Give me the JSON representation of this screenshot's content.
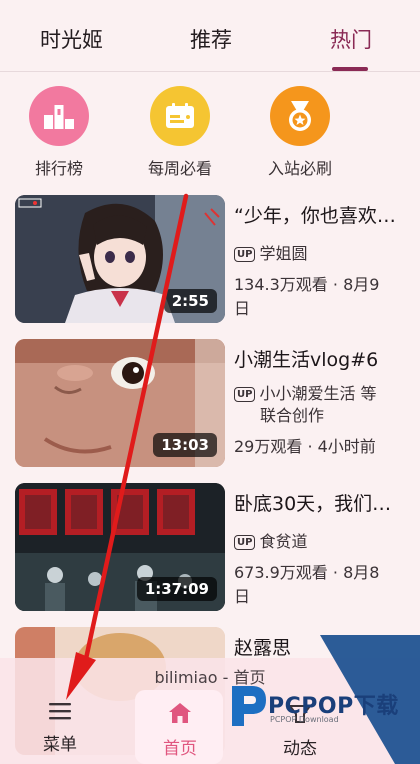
{
  "tabs": [
    {
      "label": "时光姬"
    },
    {
      "label": "推荐"
    },
    {
      "label": "热门",
      "active": true
    }
  ],
  "quick": [
    {
      "label": "排行榜",
      "icon": "ranking-icon",
      "color": "#f2799f"
    },
    {
      "label": "每周必看",
      "icon": "calendar-icon",
      "color": "#f5c532"
    },
    {
      "label": "入站必刷",
      "icon": "medal-icon",
      "color": "#f5961c"
    }
  ],
  "videos": [
    {
      "title": "“少年，你也喜欢…",
      "up": "学姐圆",
      "stats1": "134.3万观看 · 8月9",
      "stats2": "日",
      "duration": "2:55"
    },
    {
      "title": "小潮生活vlog#6",
      "up": "小小潮爱生活 等",
      "up2": "联合创作",
      "stats1": "29万观看 · 4小时前",
      "duration": "13:03"
    },
    {
      "title": "卧底30天，我们…",
      "up": "食贫道",
      "stats1": "673.9万观看 · 8月8",
      "stats2": "日",
      "duration": "1:37:09"
    },
    {
      "title": "赵露思"
    }
  ],
  "up_badge": "UP",
  "app_label": "bilimiao - 首页",
  "nav": {
    "menu": "菜单",
    "home": "首页",
    "feed": "动态"
  },
  "watermark": {
    "text": "PCPOP下载",
    "sub": "PCPOP Download"
  },
  "colors": {
    "accent": "#8a2a55",
    "home": "#e0567f",
    "arrow": "#e01b1b"
  }
}
